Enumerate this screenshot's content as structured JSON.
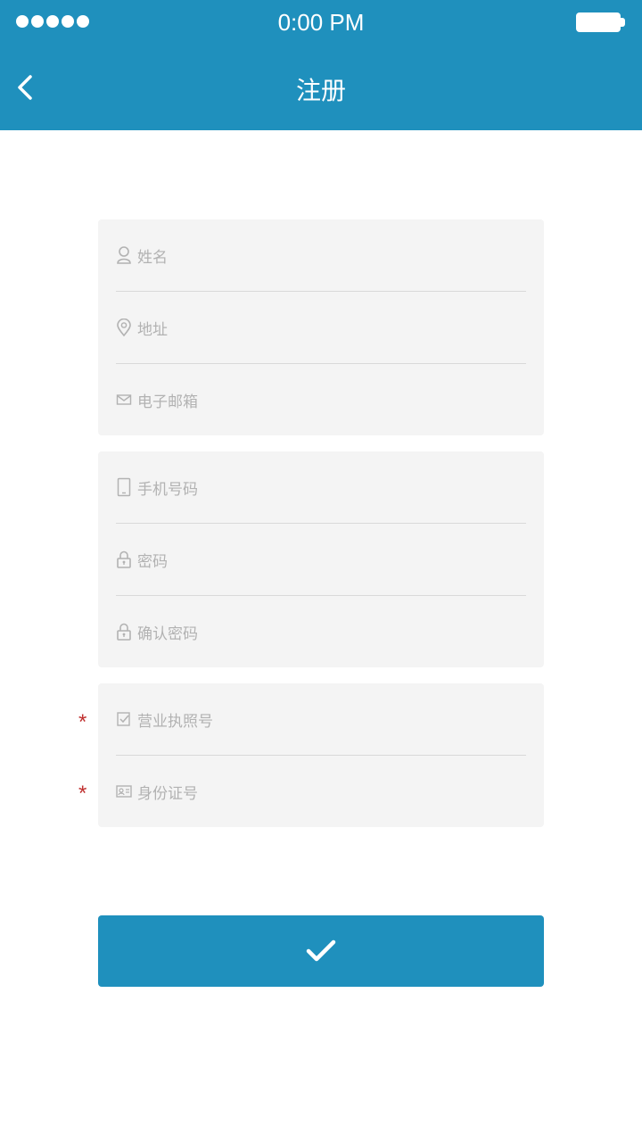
{
  "status_bar": {
    "time": "0:00 PM",
    "signal_dots": 5
  },
  "nav": {
    "title": "注册",
    "back_icon": "chevron-left-icon"
  },
  "form": {
    "group1": [
      {
        "icon": "user-icon",
        "placeholder": "姓名"
      },
      {
        "icon": "location-pin-icon",
        "placeholder": "地址"
      },
      {
        "icon": "mail-icon",
        "placeholder": "电子邮箱"
      }
    ],
    "group2": [
      {
        "icon": "phone-icon",
        "placeholder": "手机号码"
      },
      {
        "icon": "lock-icon",
        "placeholder": "密码"
      },
      {
        "icon": "lock-icon",
        "placeholder": "确认密码"
      }
    ],
    "group3": [
      {
        "icon": "license-icon",
        "placeholder": "营业执照号",
        "required_mark": "*"
      },
      {
        "icon": "id-card-icon",
        "placeholder": "身份证号",
        "required_mark": "*"
      }
    ]
  },
  "submit": {
    "icon": "checkmark-icon"
  },
  "colors": {
    "primary": "#1f90bd",
    "field_bg": "#f4f4f4",
    "placeholder": "#b2b2b2",
    "required": "#c0302f"
  }
}
